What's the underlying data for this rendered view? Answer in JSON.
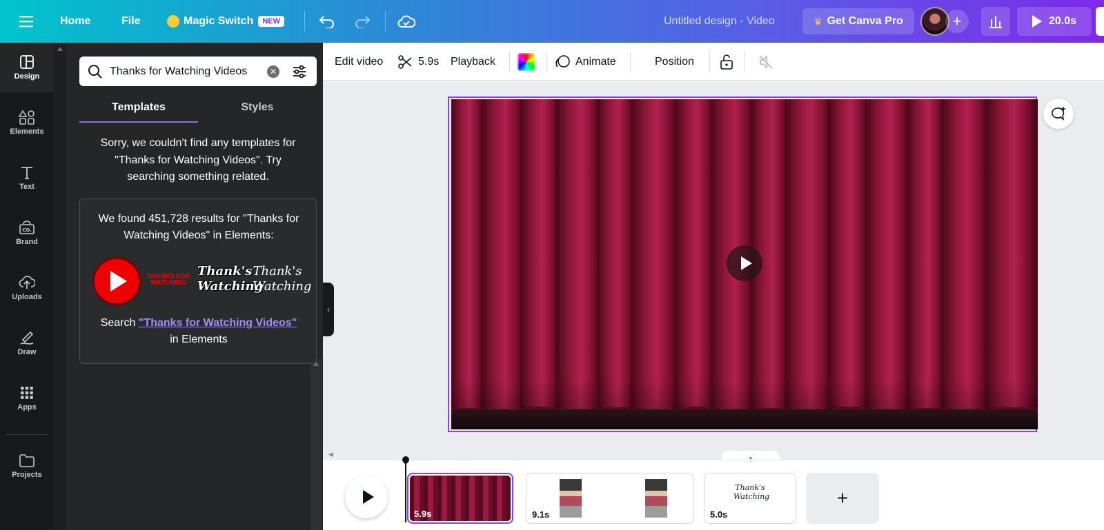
{
  "topbar": {
    "home": "Home",
    "file": "File",
    "magic_switch": "Magic Switch",
    "new_badge": "NEW",
    "design_title": "Untitled design - Video",
    "get_pro": "Get Canva Pro",
    "duration": "20.0s"
  },
  "rail": {
    "items": [
      {
        "label": "Design",
        "icon": "layout-icon"
      },
      {
        "label": "Elements",
        "icon": "shapes-icon"
      },
      {
        "label": "Text",
        "icon": "text-icon"
      },
      {
        "label": "Brand",
        "icon": "brand-icon"
      },
      {
        "label": "Uploads",
        "icon": "cloud-upload-icon"
      },
      {
        "label": "Draw",
        "icon": "pen-icon"
      },
      {
        "label": "Apps",
        "icon": "apps-grid-icon"
      },
      {
        "label": "Projects",
        "icon": "folder-icon"
      }
    ]
  },
  "panel": {
    "search_value": "Thanks for Watching Videos",
    "tabs": [
      "Templates",
      "Styles"
    ],
    "no_results": "Sorry, we couldn't find any templates for \"Thanks for Watching Videos\". Try searching something related.",
    "found_text": "We found 451,728 results for \"Thanks for Watching Videos\" in Elements:",
    "search_prefix": "Search",
    "search_link": "\"Thanks for Watching Videos\"",
    "search_suffix": "in Elements",
    "thumb_texts": [
      "THANKS FOR WATCHING",
      "Thank's Watching",
      "Thank's Watching"
    ]
  },
  "toolbar": {
    "edit_video": "Edit video",
    "trim": "5.9s",
    "playback": "Playback",
    "animate": "Animate",
    "position": "Position"
  },
  "timeline": {
    "clips": [
      {
        "duration": "5.9s"
      },
      {
        "duration": "9.1s"
      },
      {
        "duration": "5.0s"
      }
    ],
    "clip3_text": "Thank's Watching"
  },
  "colors": {
    "accent": "#8b3dff",
    "curtain": "#8a1236",
    "youtube_red": "#ff0000"
  }
}
